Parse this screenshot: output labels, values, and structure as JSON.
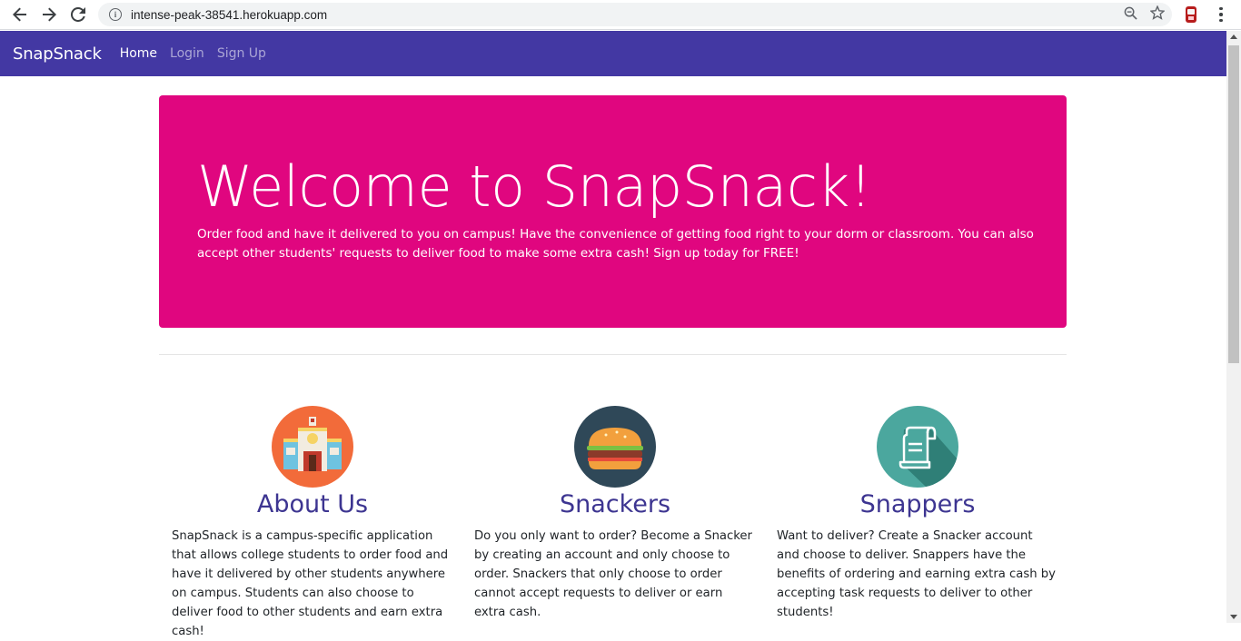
{
  "browser": {
    "url": "intense-peak-38541.herokuapp.com"
  },
  "navbar": {
    "brand": "SnapSnack",
    "links": [
      {
        "label": "Home"
      },
      {
        "label": "Login"
      },
      {
        "label": "Sign Up"
      }
    ]
  },
  "jumbotron": {
    "title": "Welcome to SnapSnack!",
    "text": "Order food and have it delivered to you on campus! Have the convenience of getting food right to your dorm or classroom. You can also accept other students' requests to deliver food to make some extra cash! Sign up today for FREE!",
    "color": "#e0067f"
  },
  "features": [
    {
      "icon": "school-building-icon",
      "title": "About Us",
      "text": "SnapSnack is a campus-specific application that allows college students to order food and have it delivered by other students anywhere on campus. Students can also choose to deliver food to other students and earn extra cash!"
    },
    {
      "icon": "burger-icon",
      "title": "Snackers",
      "text": "Do you only want to order? Become a Snacker by creating an account and only choose to order. Snackers that only choose to order cannot accept requests to deliver or earn extra cash."
    },
    {
      "icon": "receipt-icon",
      "title": "Snappers",
      "text": "Want to deliver? Create a Snacker account and choose to deliver. Snappers have the benefits of ordering and earning extra cash by accepting task requests to deliver to other students!"
    }
  ],
  "colors": {
    "navbar": "#4338a3",
    "heading": "#3d3591"
  }
}
